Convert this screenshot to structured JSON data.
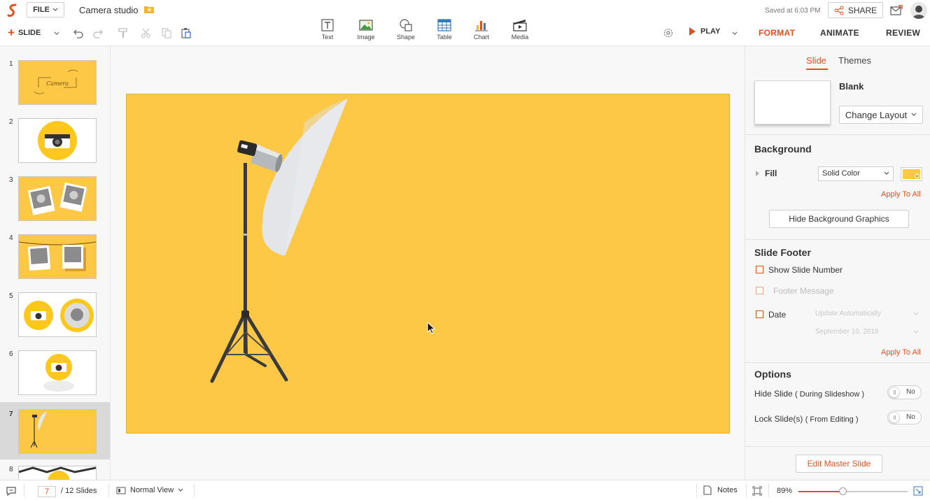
{
  "app": {
    "file_label": "FILE",
    "doc_title": "Camera studio",
    "saved_text": "Saved at 6:03 PM",
    "share_label": "SHARE"
  },
  "toolbar": {
    "slide_label": "SLIDE",
    "insert_items": [
      {
        "label": "Text",
        "icon": "text-icon"
      },
      {
        "label": "Image",
        "icon": "image-icon"
      },
      {
        "label": "Shape",
        "icon": "shape-icon"
      },
      {
        "label": "Table",
        "icon": "table-icon"
      },
      {
        "label": "Chart",
        "icon": "chart-icon"
      },
      {
        "label": "Media",
        "icon": "media-icon"
      }
    ],
    "play_label": "PLAY"
  },
  "right_tabs": [
    {
      "label": "FORMAT",
      "active": true
    },
    {
      "label": "ANIMATE",
      "active": false
    },
    {
      "label": "REVIEW",
      "active": false
    }
  ],
  "slides": {
    "numbers": [
      "1",
      "2",
      "3",
      "4",
      "5",
      "6",
      "7",
      "8"
    ],
    "selected": 7,
    "thumb1_text": "Camera"
  },
  "format_panel": {
    "subtabs": [
      {
        "label": "Slide",
        "active": true
      },
      {
        "label": "Themes",
        "active": false
      }
    ],
    "layout_name": "Blank",
    "change_layout_label": "Change Layout",
    "background_title": "Background",
    "fill_label": "Fill",
    "fill_value": "Solid Color",
    "fill_color": "#fdc845",
    "apply_to_all": "Apply To All",
    "hide_bg_label": "Hide Background Graphics",
    "footer_title": "Slide Footer",
    "show_slide_number": "Show Slide Number",
    "footer_message": "Footer Message",
    "date_label": "Date",
    "date_mode": "Update Automatically",
    "date_value": "September 10, 2018",
    "options_title": "Options",
    "hide_slide_label": "Hide Slide",
    "hide_slide_note": "( During Slideshow )",
    "lock_slide_label": "Lock Slide(s)",
    "lock_slide_note": "( From Editing )",
    "toggle_no": "No",
    "edit_master_label": "Edit Master Slide"
  },
  "status": {
    "current_page": "7",
    "total": "/ 12 Slides",
    "view_mode": "Normal View",
    "notes_label": "Notes",
    "zoom": "89%",
    "zoom_fraction": 0.41
  },
  "colors": {
    "accent": "#e0501d",
    "slide_bg": "#fdc845"
  }
}
